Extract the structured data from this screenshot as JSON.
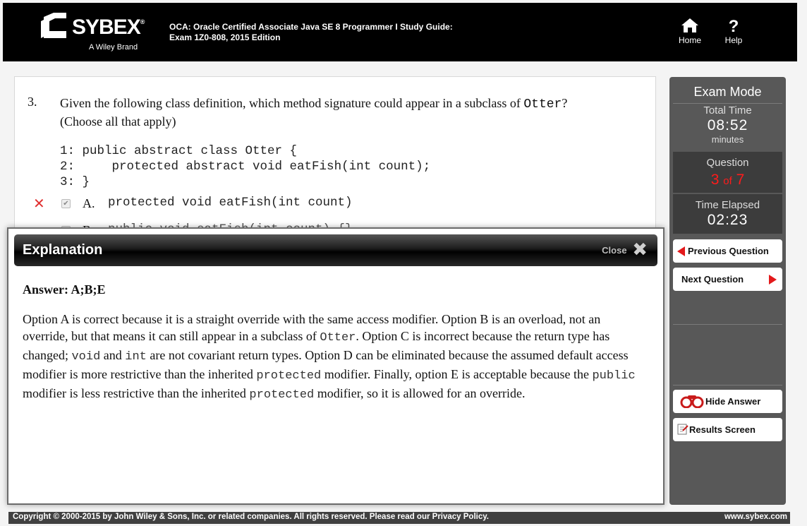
{
  "header": {
    "brand": "SYBEX",
    "tagline": "A Wiley Brand",
    "book_title_line1": "OCA: Oracle Certified Associate Java SE 8 Programmer I Study Guide:",
    "book_title_line2": "Exam 1Z0-808, 2015 Edition",
    "home_label": "Home",
    "help_label": "Help"
  },
  "question": {
    "number": "3.",
    "text_before": "Given the following class definition, which method signature could appear in a subclass of ",
    "class_name": "Otter",
    "text_after": "?",
    "line2": "(Choose all that apply)",
    "code": "1: public abstract class Otter {\n2:     protected abstract void eatFish(int count);\n3: }",
    "options": [
      {
        "letter": "A.",
        "text": "protected void eatFish(int count)",
        "status": "wrong",
        "checked": true
      },
      {
        "letter": "B.",
        "text": "public void eatFish(int count) {}",
        "status": "none",
        "checked": false
      }
    ]
  },
  "explanation": {
    "title": "Explanation",
    "close_label": "Close",
    "answer_line": "Answer: A;B;E",
    "segments": [
      {
        "t": "Option A is correct because it is a straight override with the same access modifier. Option B is an overload, not an override, but that means it can still appear in a subclass of "
      },
      {
        "c": "Otter"
      },
      {
        "t": ". Option C is incorrect because the return type has changed; "
      },
      {
        "c": "void"
      },
      {
        "t": " and "
      },
      {
        "c": "int"
      },
      {
        "t": " are not covariant return types. Option D can be eliminated because the assumed default access modifier is more restrictive than the inherited "
      },
      {
        "c": "protected"
      },
      {
        "t": " modifier. Finally, option E is acceptable because the "
      },
      {
        "c": "public"
      },
      {
        "t": " modifier is less restrictive than the inherited "
      },
      {
        "c": "protected"
      },
      {
        "t": " modifier, so it is allowed for an override."
      }
    ]
  },
  "sidebar": {
    "mode_title": "Exam Mode",
    "total_time_label": "Total Time",
    "total_time_value": "08:52",
    "total_time_unit": "minutes",
    "question_label": "Question",
    "question_current": "3",
    "question_of": "of",
    "question_total": "7",
    "time_elapsed_label": "Time Elapsed",
    "time_elapsed_value": "02:23",
    "prev_label": "Previous Question",
    "next_label": "Next Question",
    "hide_answer_label": "Hide Answer",
    "results_label": "Results Screen"
  },
  "footer": {
    "copyright": "Copyright © 2000-2015 by John Wiley & Sons, Inc. or related companies. All rights reserved. Please read our Privacy Policy.",
    "site": "www.sybex.com"
  },
  "colors": {
    "accent_red": "#e3191b",
    "sidebar_bg": "#585858",
    "header_bg": "#000000"
  }
}
